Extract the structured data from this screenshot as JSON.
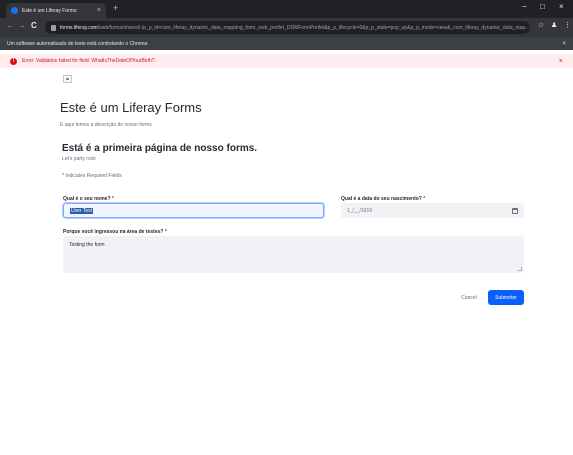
{
  "browser": {
    "tab_title": "Este é um Liferay Forms",
    "tab_close": "×",
    "new_tab": "+",
    "window_controls": {
      "minimize": "−",
      "maximize": "□",
      "close": "×"
    },
    "nav": {
      "back": "←",
      "forward": "→",
      "reload": "C"
    },
    "url_host": "forms.liferay.com",
    "url_path": "/web/forms/shared/-/p_p_id=com_liferay_dynamic_data_mapping_form_web_portlet_DDMFormPortlet&p_p_lifecycle=0&p_p_state=pop_up&p_p_mode=view&_com_liferay_dynamic_data_map...",
    "toolbar_icons": {
      "bookmark": "☆",
      "profile": "♟",
      "menu": "⋮"
    }
  },
  "infobar": {
    "message": "Um software automatizado de teste está controlando o Chrome.",
    "close": "×"
  },
  "alert": {
    "icon": "!",
    "message": "Error: Validation failed for field: WhatIsTheDateOfYourBirth?.",
    "close": "×"
  },
  "form": {
    "title": "Este é um Liferay Forms",
    "description": "E aqui temos a descrição do nosso forms",
    "page_title": "Está é a primeira página de nosso forms.",
    "page_description": "Let's party rock",
    "required_note_star": "*",
    "required_note": "Indicates Required Fields",
    "required_star": "*",
    "fields": {
      "name": {
        "label": "Qual é o seu nome?",
        "value": "User Test"
      },
      "birth_date": {
        "label": "Qual é a data do seu nascimento?",
        "placeholder": "1_/__/1919"
      },
      "reason": {
        "label": "Porque você ingressou na área de testes?",
        "value": "Testing the form"
      }
    },
    "buttons": {
      "cancel": "Cancel",
      "submit": "Submeter"
    }
  },
  "colors": {
    "primary": "#0b5fff",
    "error": "#da1414",
    "error_bg": "#fdedee",
    "field_bg": "#f1f2f5",
    "browser_dark": "#202124"
  }
}
